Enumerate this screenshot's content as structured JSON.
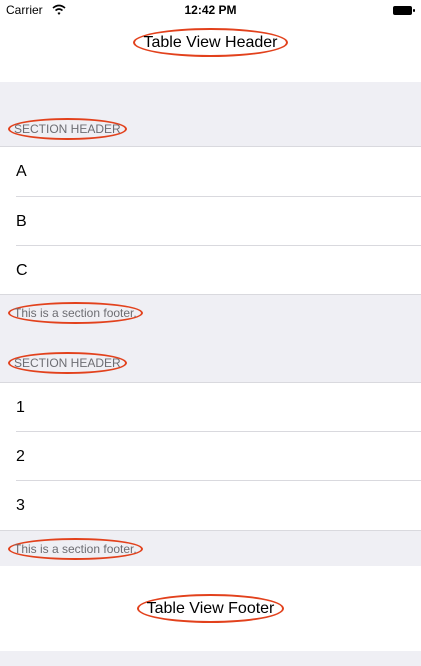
{
  "status_bar": {
    "carrier": "Carrier",
    "time": "12:42 PM"
  },
  "table_header": {
    "title": "Table View Header"
  },
  "sections": [
    {
      "header": "SECTION HEADER",
      "rows": [
        "A",
        "B",
        "C"
      ],
      "footer": "This is a section footer."
    },
    {
      "header": "SECTION HEADER",
      "rows": [
        "1",
        "2",
        "3"
      ],
      "footer": "This is a section footer."
    }
  ],
  "table_footer": {
    "title": "Table View Footer"
  },
  "colors": {
    "group_background": "#efeff4",
    "annotation": "#e2411c"
  }
}
